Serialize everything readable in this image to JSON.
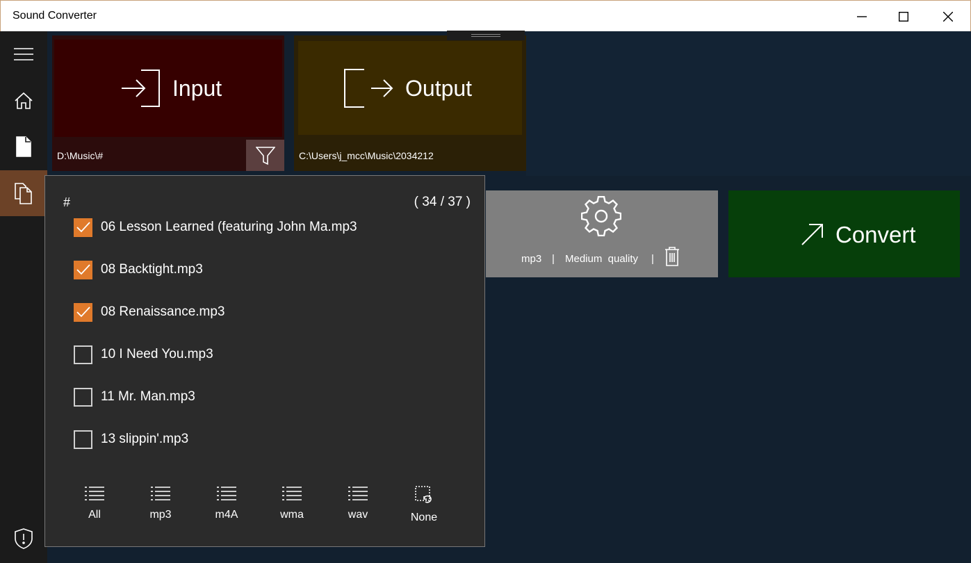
{
  "window": {
    "title": "Sound Converter"
  },
  "tiles": {
    "input": {
      "label": "Input",
      "path": "D:\\Music\\#"
    },
    "output": {
      "label": "Output",
      "path": "C:\\Users\\j_mcc\\Music\\2034212"
    }
  },
  "settings": {
    "format": "mp3",
    "sep1": "|",
    "quality": "Medium  quality",
    "sep2": "|"
  },
  "convert": {
    "label": "Convert"
  },
  "popup": {
    "folder": "#",
    "count": "( 34 / 37 )",
    "items": [
      {
        "name": "06 Lesson Learned (featuring John Ma.mp3",
        "checked": true
      },
      {
        "name": "08 Backtight.mp3",
        "checked": true
      },
      {
        "name": "08 Renaissance.mp3",
        "checked": true
      },
      {
        "name": "10 I Need You.mp3",
        "checked": false
      },
      {
        "name": "11 Mr. Man.mp3",
        "checked": false
      },
      {
        "name": "13 slippin'.mp3",
        "checked": false
      }
    ],
    "filters": [
      "All",
      "mp3",
      "m4A",
      "wma",
      "wav",
      "None"
    ]
  },
  "colors": {
    "accent": "#e07a2b",
    "input_tile": "#360000",
    "output_tile": "#3a2a00",
    "convert": "#063f0a"
  }
}
